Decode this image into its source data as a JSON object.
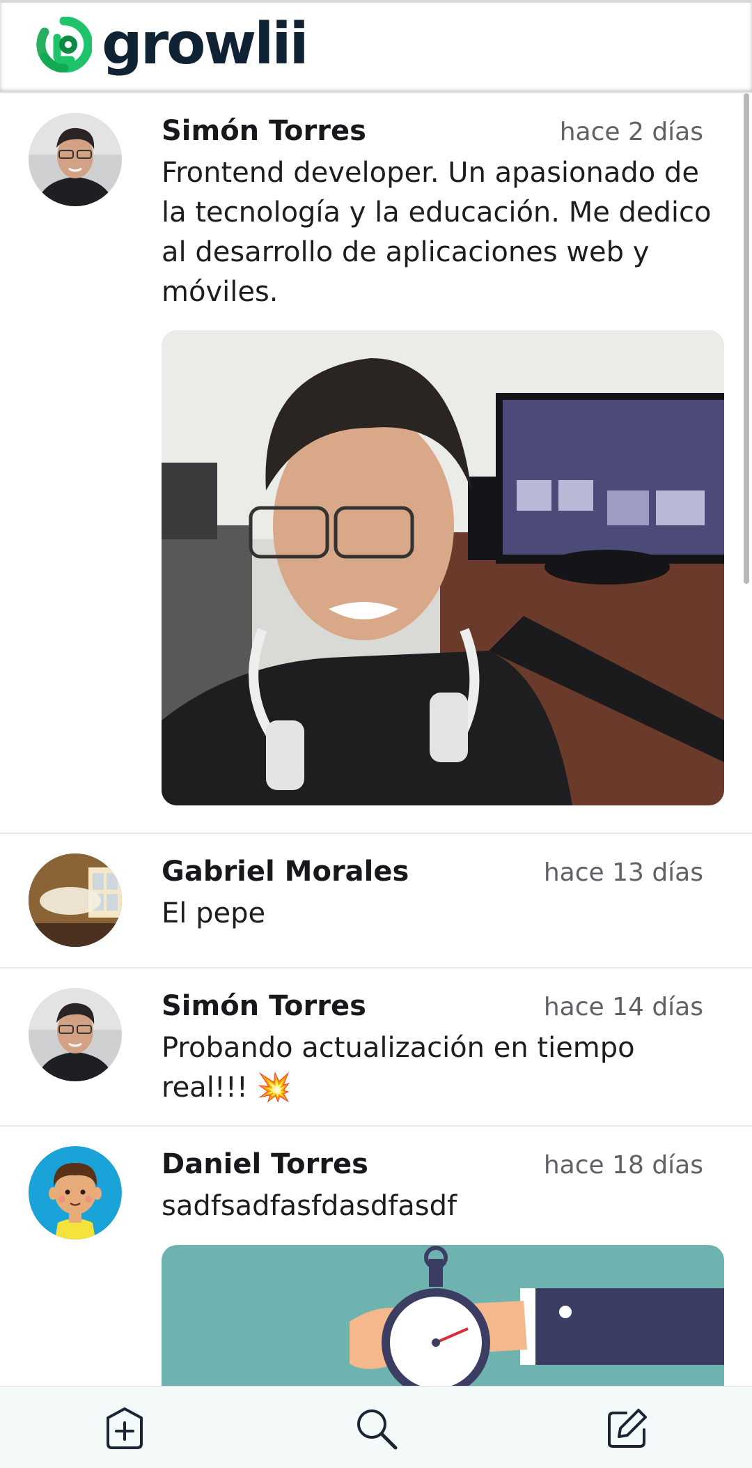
{
  "app": {
    "logo_text": "growlii",
    "brand_color": "#22c55e",
    "text_color": "#102334"
  },
  "posts": [
    {
      "author": "Simón Torres",
      "time": "hace 2 días",
      "text": "Frontend developer. Un apasionado de la tecnología y la educación. Me dedico al desarrollo de aplicaciones web y móviles.",
      "avatar": "avatar-photo-simon",
      "media": "selfie-photo-desk"
    },
    {
      "author": "Gabriel Morales",
      "time": "hace 13 días",
      "text": "El pepe",
      "avatar": "avatar-photo-room",
      "media": null
    },
    {
      "author": "Simón Torres",
      "time": "hace 14 días",
      "text": "Probando actualización en tiempo real!!! 💥",
      "avatar": "avatar-photo-simon",
      "media": null
    },
    {
      "author": "Daniel Torres",
      "time": "hace 18 días",
      "text": "sadfsadfasfdasdfasdf",
      "avatar": "avatar-cartoon-boy",
      "media": "stopwatch-illustration"
    }
  ],
  "bottom_nav": {
    "items": [
      "add-icon",
      "search-icon",
      "compose-icon"
    ]
  }
}
